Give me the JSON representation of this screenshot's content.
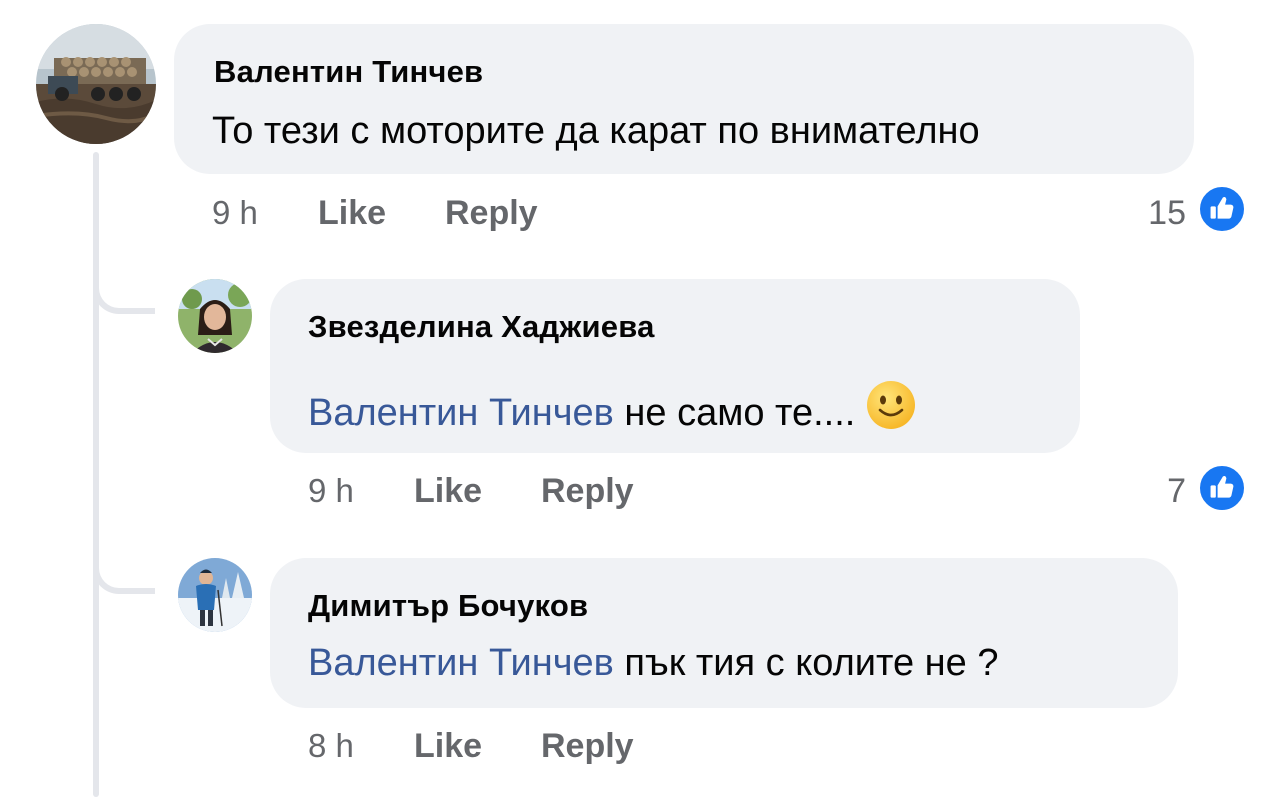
{
  "comments": [
    {
      "author": "Валентин Тинчев",
      "mention": "",
      "text": "То тези с моторите да карат по внимателно",
      "time": "9 h",
      "like_label": "Like",
      "reply_label": "Reply",
      "like_count": "15",
      "avatar_icon": "truck-photo-avatar"
    },
    {
      "author": "Звезделина Хаджиева",
      "mention": "Валентин Тинчев",
      "text": "не само те....",
      "emoji": "slightly-smiling-face-emoji",
      "time": "9 h",
      "like_label": "Like",
      "reply_label": "Reply",
      "like_count": "7",
      "avatar_icon": "woman-portrait-avatar"
    },
    {
      "author": "Димитър Бочуков",
      "mention": "Валентин Тинчев",
      "text": "пък тия с колите не ?",
      "time": "8 h",
      "like_label": "Like",
      "reply_label": "Reply",
      "avatar_icon": "skier-snow-avatar"
    }
  ],
  "colors": {
    "bubble_bg": "#f0f2f5",
    "mention": "#385898",
    "meta_text": "#65676b",
    "like_blue": "#1877f2",
    "thread_line": "#e4e6eb"
  }
}
